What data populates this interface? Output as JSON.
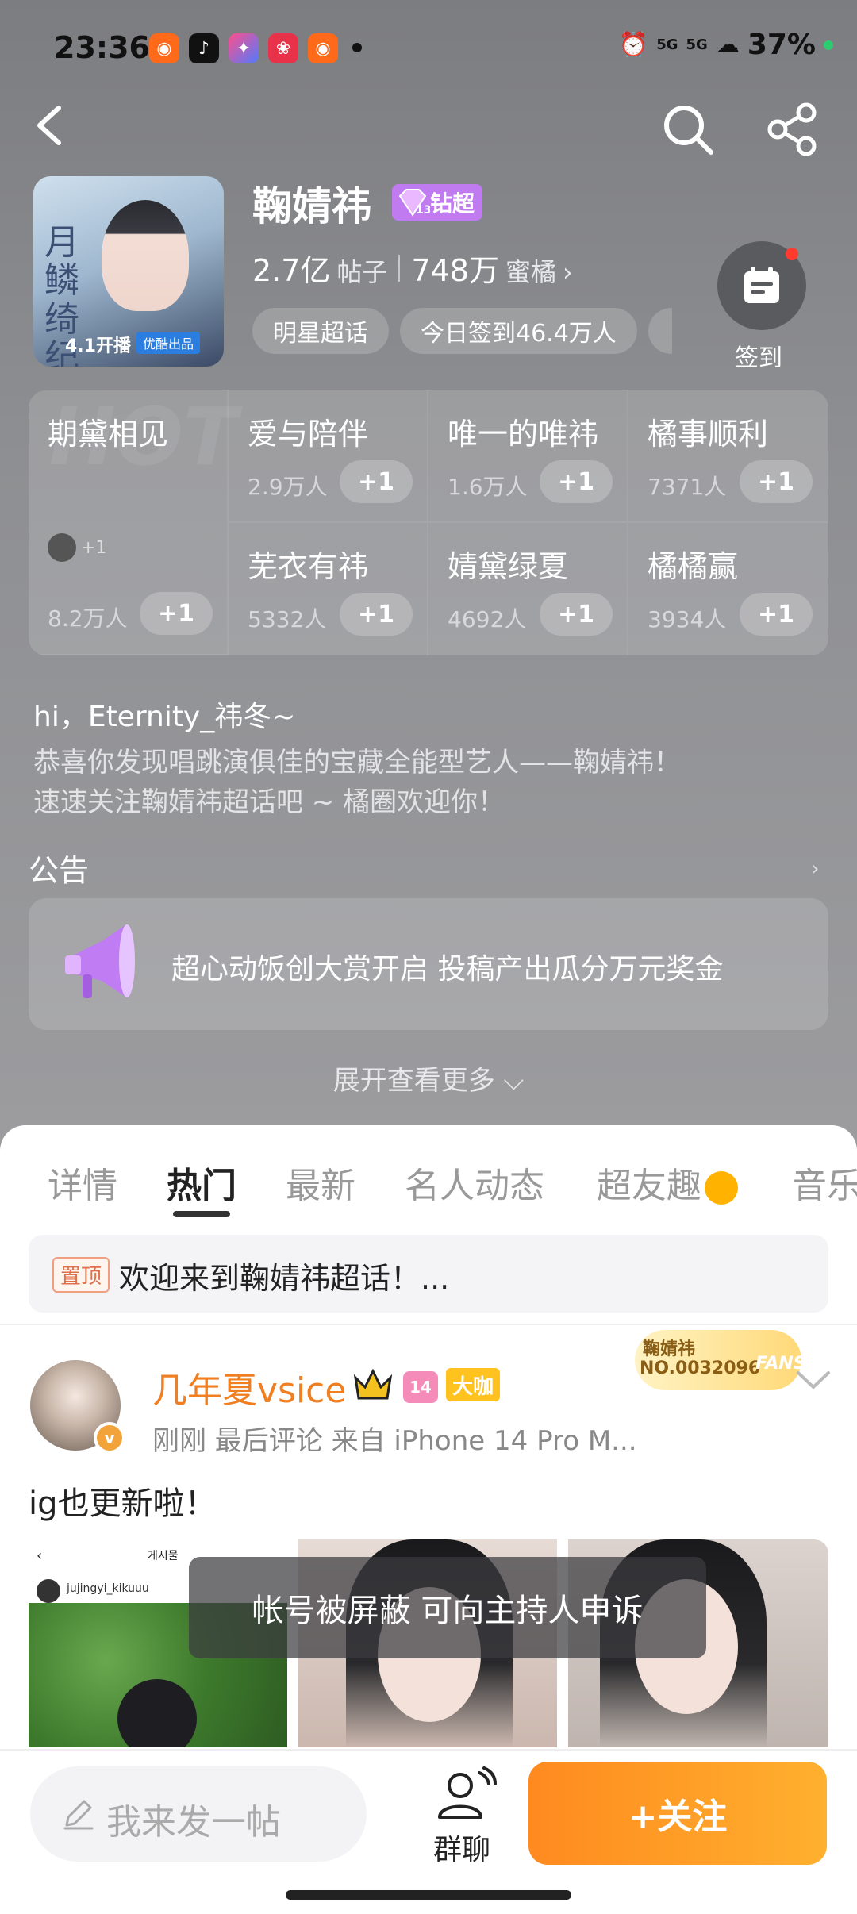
{
  "status_bar": {
    "time": "23:36",
    "battery": "37%",
    "network": "5G"
  },
  "header": {
    "name": "鞠婧祎",
    "vip_label": "钻超",
    "posts_count": "2.7亿",
    "posts_unit": "帖子",
    "fans_count": "748万",
    "fans_unit": "蜜橘",
    "fans_arrow": "›",
    "tags": [
      "明星超话",
      "今日签到46.4万人"
    ],
    "checkin_label": "签到",
    "cover": {
      "title": "月鳞绮纪",
      "date": "4.1开播",
      "badge": "优酷出品"
    }
  },
  "hot_grid": {
    "watermark": "HOT",
    "first": {
      "title": "期黛相见",
      "count": "8.2万人",
      "plus": "+1",
      "mini": "+1"
    },
    "items": [
      {
        "title": "爱与陪伴",
        "count": "2.9万人",
        "plus": "+1"
      },
      {
        "title": "唯一的唯祎",
        "count": "1.6万人",
        "plus": "+1"
      },
      {
        "title": "橘事顺利",
        "count": "7371人",
        "plus": "+1"
      },
      {
        "title": "芜衣有祎",
        "count": "5332人",
        "plus": "+1"
      },
      {
        "title": "婧黛绿夏",
        "count": "4692人",
        "plus": "+1"
      },
      {
        "title": "橘橘赢",
        "count": "3934人",
        "plus": "+1"
      }
    ]
  },
  "welcome": {
    "greeting": "hi，Eternity_祎冬~",
    "line1": "恭喜你发现唱跳演俱佳的宝藏全能型艺人——鞠婧祎！",
    "line2": "速速关注鞠婧祎超话吧 ~ 橘圈欢迎你！"
  },
  "notice": {
    "heading": "公告",
    "arrow": "›",
    "text": "超心动饭创大赏开启 投稿产出瓜分万元奖金"
  },
  "expand_label": "展开查看更多",
  "tabs": [
    "详情",
    "热门",
    "最新",
    "名人动态",
    "超友趣",
    "音乐"
  ],
  "active_tab": "热门",
  "pinned": {
    "tag": "置顶",
    "text": "欢迎来到鞠婧祎超话！..."
  },
  "post": {
    "username": "几年夏vsice",
    "level": "14",
    "role_badge": "大咖",
    "meta": "刚刚 最后评论   来自 iPhone 14 Pro M...",
    "fans_badge_name": "鞠婧祎",
    "fans_badge_no": "NO.0032096",
    "fans_badge_word": "FANS",
    "text": "ig也更新啦！",
    "photo1_header": "게시물",
    "photo1_user": "jujingyi_kikuuu",
    "blocked_toast": "帐号被屏蔽 可向主持人申诉"
  },
  "bottom_bar": {
    "post_placeholder": "我来发一帖",
    "group_label": "群聊",
    "follow_label": "+关注"
  }
}
